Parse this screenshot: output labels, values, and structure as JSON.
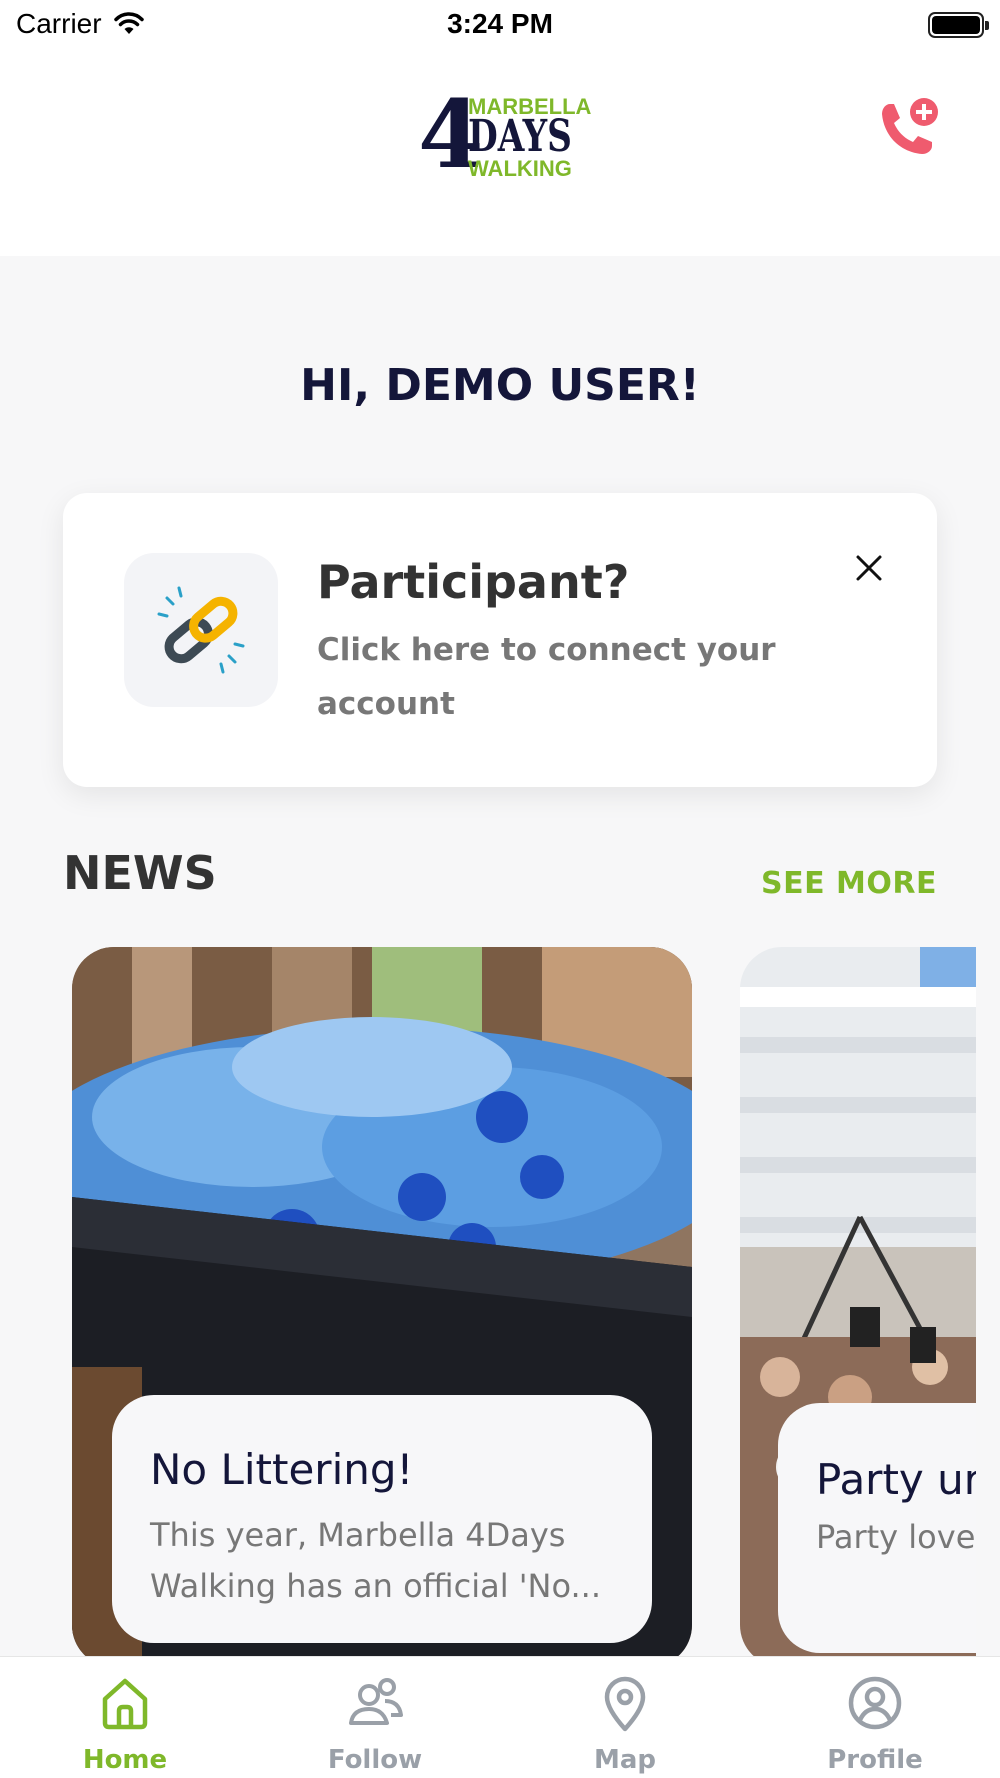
{
  "status_bar": {
    "carrier": "Carrier",
    "time": "3:24 PM"
  },
  "header": {
    "logo": {
      "number": "4",
      "top": "MARBELLA",
      "middle": "DAYS",
      "bottom": "WALKING"
    },
    "emergency_icon": "phone-plus-icon"
  },
  "greeting": "HI, DEMO USER!",
  "participant_card": {
    "title": "Participant?",
    "subtitle": "Click here to connect your account",
    "icon": "link-icon",
    "close_icon": "close-icon"
  },
  "news": {
    "title": "NEWS",
    "see_more": "SEE MORE",
    "items": [
      {
        "headline": "No Littering!",
        "excerpt": "This year, Marbella 4Days\nWalking has an official 'No..."
      },
      {
        "headline": "Party ur",
        "excerpt": "Party love\nthemselve"
      }
    ]
  },
  "tabs": [
    {
      "label": "Home",
      "icon": "home-icon",
      "active": true
    },
    {
      "label": "Follow",
      "icon": "people-icon",
      "active": false
    },
    {
      "label": "Map",
      "icon": "map-pin-icon",
      "active": false
    },
    {
      "label": "Profile",
      "icon": "profile-icon",
      "active": false
    }
  ],
  "colors": {
    "brand_green": "#7fb82a",
    "navy": "#14163a",
    "emergency": "#ef5b6e"
  }
}
